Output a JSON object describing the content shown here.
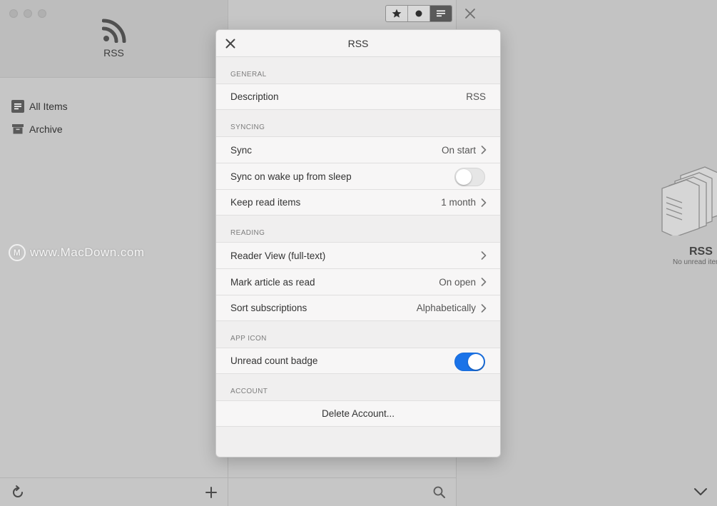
{
  "sidebar": {
    "feed_title": "RSS",
    "items": [
      {
        "label": "All Items",
        "icon": "all-items-icon"
      },
      {
        "label": "Archive",
        "icon": "archive-icon"
      }
    ]
  },
  "watermark": {
    "text": "www.MacDown.com",
    "logo": "M"
  },
  "detail": {
    "empty_title": "RSS",
    "empty_subtitle": "No unread items"
  },
  "modal": {
    "title": "RSS",
    "sections": {
      "general": {
        "label": "GENERAL",
        "description": {
          "label": "Description",
          "value": "RSS"
        }
      },
      "syncing": {
        "label": "SYNCING",
        "sync": {
          "label": "Sync",
          "value": "On start"
        },
        "sync_on_wake": {
          "label": "Sync on wake up from sleep",
          "enabled": false
        },
        "keep_read": {
          "label": "Keep read items",
          "value": "1 month"
        }
      },
      "reading": {
        "label": "READING",
        "reader_view": {
          "label": "Reader View (full-text)"
        },
        "mark_read": {
          "label": "Mark article as read",
          "value": "On open"
        },
        "sort": {
          "label": "Sort subscriptions",
          "value": "Alphabetically"
        }
      },
      "app_icon": {
        "label": "APP ICON",
        "unread_badge": {
          "label": "Unread count badge",
          "enabled": true
        }
      },
      "account": {
        "label": "ACCOUNT",
        "delete": {
          "label": "Delete Account..."
        }
      }
    }
  },
  "colors": {
    "toggle_on": "#1a73e8",
    "background": "#c4c4c4"
  }
}
